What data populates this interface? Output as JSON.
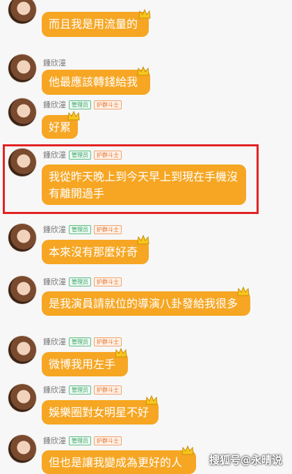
{
  "sender": {
    "name": "鍾欣潼",
    "admin_badge": "管理员",
    "guard_badge": "护群斗士"
  },
  "messages": [
    {
      "text": "而且我是用流量的",
      "badges": false
    },
    {
      "text": "他最應該轉錢給我",
      "badges": false
    },
    {
      "text": "好累",
      "badges": true
    },
    {
      "text": "我從昨天晚上到今天早上到現在手機沒有離開過手",
      "badges": true,
      "line1": "我從昨天晚上到今天早上到現在手機沒",
      "line2": "有離開過手"
    },
    {
      "text": "本來沒有那麼好奇",
      "badges": true
    },
    {
      "text": "是我演員請就位的導演八卦發給我很多",
      "badges": true
    },
    {
      "text": "微博我用左手",
      "badges": true
    },
    {
      "text": "娛樂圈對女明星不好",
      "badges": true
    },
    {
      "text": "但也是讓我變成為更好的人",
      "badges": true
    }
  ],
  "watermark": "搜狐号@永晴说",
  "colors": {
    "bubble": "#f6a623",
    "highlight": "#e32222"
  },
  "icons": [
    "crown-icon"
  ]
}
